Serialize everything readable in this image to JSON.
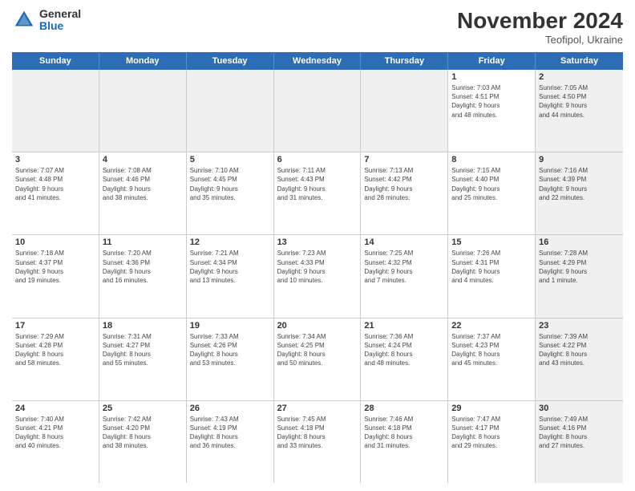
{
  "logo": {
    "general": "General",
    "blue": "Blue"
  },
  "title": "November 2024",
  "location": "Teofipol, Ukraine",
  "days_of_week": [
    "Sunday",
    "Monday",
    "Tuesday",
    "Wednesday",
    "Thursday",
    "Friday",
    "Saturday"
  ],
  "weeks": [
    [
      {
        "day": "",
        "info": "",
        "shaded": true
      },
      {
        "day": "",
        "info": "",
        "shaded": true
      },
      {
        "day": "",
        "info": "",
        "shaded": true
      },
      {
        "day": "",
        "info": "",
        "shaded": true
      },
      {
        "day": "",
        "info": "",
        "shaded": true
      },
      {
        "day": "1",
        "info": "Sunrise: 7:03 AM\nSunset: 4:51 PM\nDaylight: 9 hours\nand 48 minutes.",
        "shaded": false
      },
      {
        "day": "2",
        "info": "Sunrise: 7:05 AM\nSunset: 4:50 PM\nDaylight: 9 hours\nand 44 minutes.",
        "shaded": true
      }
    ],
    [
      {
        "day": "3",
        "info": "Sunrise: 7:07 AM\nSunset: 4:48 PM\nDaylight: 9 hours\nand 41 minutes.",
        "shaded": false
      },
      {
        "day": "4",
        "info": "Sunrise: 7:08 AM\nSunset: 4:46 PM\nDaylight: 9 hours\nand 38 minutes.",
        "shaded": false
      },
      {
        "day": "5",
        "info": "Sunrise: 7:10 AM\nSunset: 4:45 PM\nDaylight: 9 hours\nand 35 minutes.",
        "shaded": false
      },
      {
        "day": "6",
        "info": "Sunrise: 7:11 AM\nSunset: 4:43 PM\nDaylight: 9 hours\nand 31 minutes.",
        "shaded": false
      },
      {
        "day": "7",
        "info": "Sunrise: 7:13 AM\nSunset: 4:42 PM\nDaylight: 9 hours\nand 28 minutes.",
        "shaded": false
      },
      {
        "day": "8",
        "info": "Sunrise: 7:15 AM\nSunset: 4:40 PM\nDaylight: 9 hours\nand 25 minutes.",
        "shaded": false
      },
      {
        "day": "9",
        "info": "Sunrise: 7:16 AM\nSunset: 4:39 PM\nDaylight: 9 hours\nand 22 minutes.",
        "shaded": true
      }
    ],
    [
      {
        "day": "10",
        "info": "Sunrise: 7:18 AM\nSunset: 4:37 PM\nDaylight: 9 hours\nand 19 minutes.",
        "shaded": false
      },
      {
        "day": "11",
        "info": "Sunrise: 7:20 AM\nSunset: 4:36 PM\nDaylight: 9 hours\nand 16 minutes.",
        "shaded": false
      },
      {
        "day": "12",
        "info": "Sunrise: 7:21 AM\nSunset: 4:34 PM\nDaylight: 9 hours\nand 13 minutes.",
        "shaded": false
      },
      {
        "day": "13",
        "info": "Sunrise: 7:23 AM\nSunset: 4:33 PM\nDaylight: 9 hours\nand 10 minutes.",
        "shaded": false
      },
      {
        "day": "14",
        "info": "Sunrise: 7:25 AM\nSunset: 4:32 PM\nDaylight: 9 hours\nand 7 minutes.",
        "shaded": false
      },
      {
        "day": "15",
        "info": "Sunrise: 7:26 AM\nSunset: 4:31 PM\nDaylight: 9 hours\nand 4 minutes.",
        "shaded": false
      },
      {
        "day": "16",
        "info": "Sunrise: 7:28 AM\nSunset: 4:29 PM\nDaylight: 9 hours\nand 1 minute.",
        "shaded": true
      }
    ],
    [
      {
        "day": "17",
        "info": "Sunrise: 7:29 AM\nSunset: 4:28 PM\nDaylight: 8 hours\nand 58 minutes.",
        "shaded": false
      },
      {
        "day": "18",
        "info": "Sunrise: 7:31 AM\nSunset: 4:27 PM\nDaylight: 8 hours\nand 55 minutes.",
        "shaded": false
      },
      {
        "day": "19",
        "info": "Sunrise: 7:33 AM\nSunset: 4:26 PM\nDaylight: 8 hours\nand 53 minutes.",
        "shaded": false
      },
      {
        "day": "20",
        "info": "Sunrise: 7:34 AM\nSunset: 4:25 PM\nDaylight: 8 hours\nand 50 minutes.",
        "shaded": false
      },
      {
        "day": "21",
        "info": "Sunrise: 7:36 AM\nSunset: 4:24 PM\nDaylight: 8 hours\nand 48 minutes.",
        "shaded": false
      },
      {
        "day": "22",
        "info": "Sunrise: 7:37 AM\nSunset: 4:23 PM\nDaylight: 8 hours\nand 45 minutes.",
        "shaded": false
      },
      {
        "day": "23",
        "info": "Sunrise: 7:39 AM\nSunset: 4:22 PM\nDaylight: 8 hours\nand 43 minutes.",
        "shaded": true
      }
    ],
    [
      {
        "day": "24",
        "info": "Sunrise: 7:40 AM\nSunset: 4:21 PM\nDaylight: 8 hours\nand 40 minutes.",
        "shaded": false
      },
      {
        "day": "25",
        "info": "Sunrise: 7:42 AM\nSunset: 4:20 PM\nDaylight: 8 hours\nand 38 minutes.",
        "shaded": false
      },
      {
        "day": "26",
        "info": "Sunrise: 7:43 AM\nSunset: 4:19 PM\nDaylight: 8 hours\nand 36 minutes.",
        "shaded": false
      },
      {
        "day": "27",
        "info": "Sunrise: 7:45 AM\nSunset: 4:18 PM\nDaylight: 8 hours\nand 33 minutes.",
        "shaded": false
      },
      {
        "day": "28",
        "info": "Sunrise: 7:46 AM\nSunset: 4:18 PM\nDaylight: 8 hours\nand 31 minutes.",
        "shaded": false
      },
      {
        "day": "29",
        "info": "Sunrise: 7:47 AM\nSunset: 4:17 PM\nDaylight: 8 hours\nand 29 minutes.",
        "shaded": false
      },
      {
        "day": "30",
        "info": "Sunrise: 7:49 AM\nSunset: 4:16 PM\nDaylight: 8 hours\nand 27 minutes.",
        "shaded": true
      }
    ]
  ]
}
